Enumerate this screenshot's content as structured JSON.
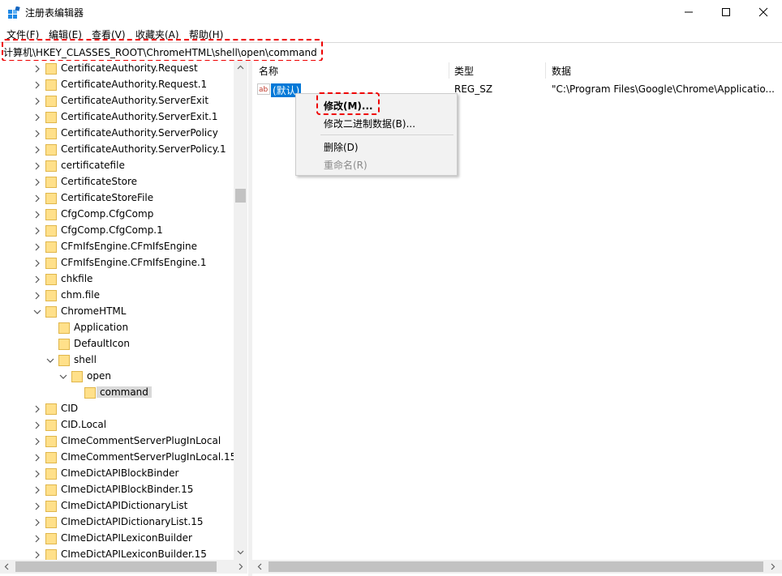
{
  "window": {
    "title": "注册表编辑器",
    "app_icon": "registry-editor-icon",
    "controls": [
      "minimize-icon",
      "maximize-icon",
      "close-icon"
    ]
  },
  "menu": [
    "文件(F)",
    "编辑(E)",
    "查看(V)",
    "收藏夹(A)",
    "帮助(H)"
  ],
  "address": {
    "path": "计算机\\HKEY_CLASSES_ROOT\\ChromeHTML\\shell\\open\\command",
    "highlight_color": "#e00000"
  },
  "tree": {
    "items": [
      {
        "label": "CertificateAuthority.Request",
        "expander": "collapsed"
      },
      {
        "label": "CertificateAuthority.Request.1",
        "expander": "collapsed"
      },
      {
        "label": "CertificateAuthority.ServerExit",
        "expander": "collapsed"
      },
      {
        "label": "CertificateAuthority.ServerExit.1",
        "expander": "collapsed"
      },
      {
        "label": "CertificateAuthority.ServerPolicy",
        "expander": "collapsed"
      },
      {
        "label": "CertificateAuthority.ServerPolicy.1",
        "expander": "collapsed"
      },
      {
        "label": "certificatefile",
        "expander": "collapsed"
      },
      {
        "label": "CertificateStore",
        "expander": "collapsed"
      },
      {
        "label": "CertificateStoreFile",
        "expander": "collapsed"
      },
      {
        "label": "CfgComp.CfgComp",
        "expander": "collapsed"
      },
      {
        "label": "CfgComp.CfgComp.1",
        "expander": "collapsed"
      },
      {
        "label": "CFmIfsEngine.CFmIfsEngine",
        "expander": "collapsed"
      },
      {
        "label": "CFmIfsEngine.CFmIfsEngine.1",
        "expander": "collapsed"
      },
      {
        "label": "chkfile",
        "expander": "collapsed"
      },
      {
        "label": "chm.file",
        "expander": "collapsed"
      },
      {
        "label": "ChromeHTML",
        "expander": "expanded"
      },
      {
        "label": "Application",
        "expander": "none"
      },
      {
        "label": "DefaultIcon",
        "expander": "none"
      },
      {
        "label": "shell",
        "expander": "expanded"
      },
      {
        "label": "open",
        "expander": "expanded"
      },
      {
        "label": "command",
        "expander": "none",
        "selected": true
      },
      {
        "label": "CID",
        "expander": "collapsed"
      },
      {
        "label": "CID.Local",
        "expander": "collapsed"
      },
      {
        "label": "CImeCommentServerPlugInLocal",
        "expander": "collapsed"
      },
      {
        "label": "CImeCommentServerPlugInLocal.15",
        "expander": "collapsed"
      },
      {
        "label": "CImeDictAPIBlockBinder",
        "expander": "collapsed"
      },
      {
        "label": "CImeDictAPIBlockBinder.15",
        "expander": "collapsed"
      },
      {
        "label": "CImeDictAPIDictionaryList",
        "expander": "collapsed"
      },
      {
        "label": "CImeDictAPIDictionaryList.15",
        "expander": "collapsed"
      },
      {
        "label": "CImeDictAPILexiconBuilder",
        "expander": "collapsed"
      },
      {
        "label": "CImeDictAPILexiconBuilder.15",
        "expander": "collapsed"
      }
    ]
  },
  "list": {
    "columns": [
      "名称",
      "类型",
      "数据"
    ],
    "rows": [
      {
        "name": "(默认)",
        "type": "REG_SZ",
        "data": "\"C:\\Program Files\\Google\\Chrome\\Applicatio...",
        "icon": "string-value-icon"
      }
    ]
  },
  "context_menu": {
    "items": [
      {
        "label": "修改(M)...",
        "bold": true,
        "enabled": true
      },
      {
        "label": "修改二进制数据(B)...",
        "enabled": true
      },
      {
        "label": "删除(D)",
        "enabled": true
      },
      {
        "label": "重命名(R)",
        "enabled": false
      }
    ]
  }
}
